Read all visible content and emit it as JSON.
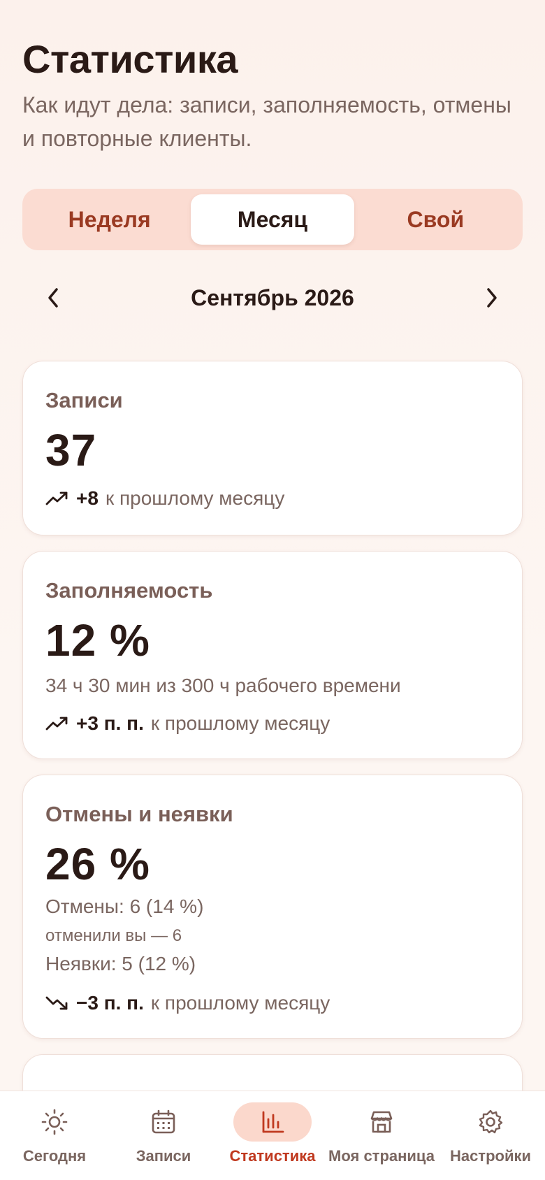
{
  "header": {
    "title": "Статистика",
    "subtitle": "Как идут дела: записи, заполняемость, отмены и повторные клиенты."
  },
  "period_tabs": [
    {
      "label": "Неделя",
      "active": false
    },
    {
      "label": "Месяц",
      "active": true
    },
    {
      "label": "Свой",
      "active": false
    }
  ],
  "period_nav": {
    "label": "Сентябрь 2026",
    "prev_icon": "chevron-left-icon",
    "next_icon": "chevron-right-icon"
  },
  "cards": {
    "bookings": {
      "label": "Записи",
      "value": "37",
      "trend_icon": "trending-up-icon",
      "trend_delta": "+8",
      "trend_text": "к прошлому месяцу"
    },
    "occupancy": {
      "label": "Заполняемость",
      "value": "12 %",
      "detail": "34 ч 30 мин из 300 ч рабочего времени",
      "trend_icon": "trending-up-icon",
      "trend_delta": "+3 п. п.",
      "trend_text": "к прошлому месяцу"
    },
    "cancellations": {
      "label": "Отмены и неявки",
      "value": "26 %",
      "cancel_line": "Отмены: 6 (14 %)",
      "cancel_by_you": "отменили вы — 6",
      "noshow_line": "Неявки: 5 (12 %)",
      "trend_icon": "trending-down-icon",
      "trend_delta": "−3 п. п.",
      "trend_text": "к прошлому месяцу"
    }
  },
  "tabbar": [
    {
      "label": "Сегодня",
      "icon": "sun-icon",
      "active": false
    },
    {
      "label": "Записи",
      "icon": "calendar-icon",
      "active": false
    },
    {
      "label": "Статистика",
      "icon": "bar-chart-icon",
      "active": true
    },
    {
      "label": "Моя страница",
      "icon": "store-icon",
      "active": false
    },
    {
      "label": "Настройки",
      "icon": "gear-icon",
      "active": false
    }
  ],
  "colors": {
    "accent": "#c0391f",
    "segment_bg": "#fbdcd2",
    "active_tab_bg": "#fbd8cc"
  }
}
